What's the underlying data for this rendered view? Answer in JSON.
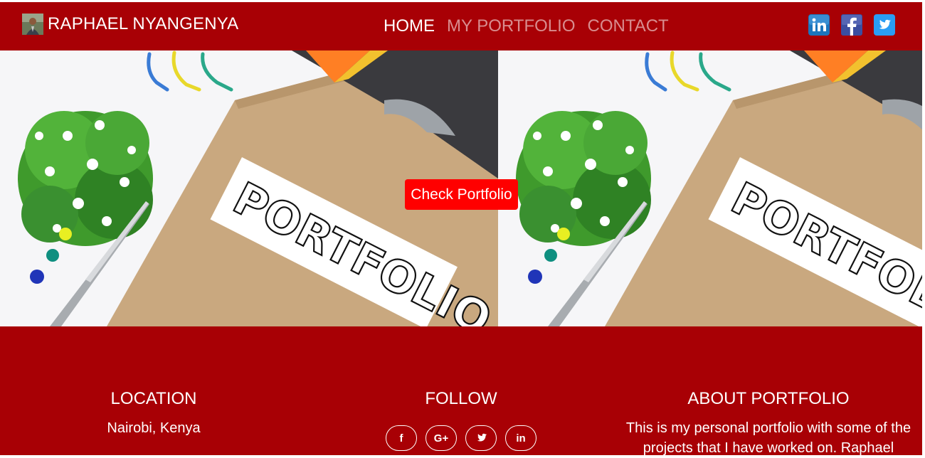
{
  "navbar": {
    "brand": "RAPHAEL NYANGENYA",
    "links": [
      {
        "label": "HOME",
        "active": true
      },
      {
        "label": "MY PORTFOLIO",
        "active": false
      },
      {
        "label": "CONTACT",
        "active": false
      }
    ],
    "socials": [
      "linkedin-icon",
      "facebook-icon",
      "twitter-icon"
    ]
  },
  "hero": {
    "banner_text": "PORTFOLIO",
    "cta_label": "Check Portfolio"
  },
  "footer": {
    "location": {
      "heading": "LOCATION",
      "text": "Nairobi, Kenya"
    },
    "follow": {
      "heading": "FOLLOW",
      "icons": [
        {
          "name": "facebook-icon",
          "glyph": "f"
        },
        {
          "name": "google-plus-icon",
          "glyph": "G+"
        },
        {
          "name": "twitter-icon",
          "glyph": ""
        },
        {
          "name": "linkedin-icon",
          "glyph": "in"
        }
      ]
    },
    "about": {
      "heading": "ABOUT PORTFOLIO",
      "text": "This is my personal portfolio with some of the projects that I have worked on. Raphael"
    }
  },
  "colors": {
    "brand_red": "#a80005",
    "cta_red": "#ff0000",
    "linkedin": "#1c75bc",
    "facebook": "#3b4ea0",
    "twitter": "#2a9df4"
  }
}
